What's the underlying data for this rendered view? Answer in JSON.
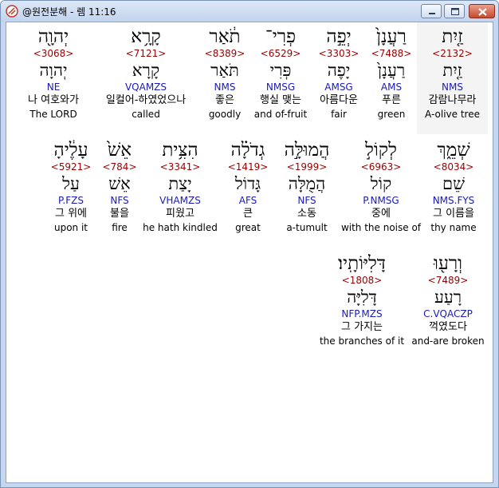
{
  "window": {
    "title": "@원전분해 - 렘 11:16",
    "buttons": {
      "minimize": "minimize",
      "maximize": "maximize",
      "close": "close"
    }
  },
  "words": [
    {
      "heb": "זַ֤יִת",
      "strong": "<2132>",
      "heb2": "זַ֤יִת",
      "morph": "NMS",
      "korean": "감람나무라",
      "english": "A-olive tree"
    },
    {
      "heb": "רַעֲנָן֙",
      "strong": "<7488>",
      "heb2": "רַעֲנָן֙",
      "morph": "AMS",
      "korean": "푸른",
      "english": "green"
    },
    {
      "heb": "יְפֵ֣ה",
      "strong": "<3303>",
      "heb2": "יָפֶה",
      "morph": "AMSG",
      "korean": "아름다운",
      "english": "fair"
    },
    {
      "heb": "פְרִי־",
      "strong": "<6529>",
      "heb2": "פְּרִי",
      "morph": "NMSG",
      "korean": "행실 맺는",
      "english": "and of-fruit"
    },
    {
      "heb": "תֹ֔אַר",
      "strong": "<8389>",
      "heb2": "תֹּאַר",
      "morph": "NMS",
      "korean": "좋은",
      "english": "goodly"
    },
    {
      "heb": "קָרָ֥א",
      "strong": "<7121>",
      "heb2": "קָרָא",
      "morph": "VQAMZS",
      "korean": "일컬어-하였었으나",
      "english": "called"
    },
    {
      "heb": "יְהוָ֖ה",
      "strong": "<3068>",
      "heb2": "יְהוָה",
      "morph": "NE",
      "korean": "나 여호와가",
      "english": "The LORD"
    },
    {
      "heb": "שְׁמֵ֑ךְ",
      "strong": "<8034>",
      "heb2": "שֵׁם",
      "morph": "NMS.FYS",
      "korean": "그 이름을",
      "english": "thy name"
    },
    {
      "heb": "לְקוֹל֣",
      "strong": "<6963>",
      "heb2": "קוֹל",
      "morph": "P.NMSG",
      "korean": "중에",
      "english": "with the noise of"
    },
    {
      "heb": "הֲמוּלָּ֣ה",
      "strong": "<1999>",
      "heb2": "הֲמֻלָּה",
      "morph": "NFS",
      "korean": "소동",
      "english": "a-tumult"
    },
    {
      "heb": "גְדֹלָ֗ה",
      "strong": "<1419>",
      "heb2": "גָּדוֹל",
      "morph": "AFS",
      "korean": "큰",
      "english": "great"
    },
    {
      "heb": "הִצִּ֥ית",
      "strong": "<3341>",
      "heb2": "יָצַת",
      "morph": "VHAMZS",
      "korean": "피웠고",
      "english": "he hath kindled"
    },
    {
      "heb": "אֵשׁ֙",
      "strong": "<784>",
      "heb2": "אֵשׁ",
      "morph": "NFS",
      "korean": "불을",
      "english": "fire"
    },
    {
      "heb": "עָלֶ֔יהָ",
      "strong": "<5921>",
      "heb2": "עַל",
      "morph": "P.FZS",
      "korean": "그 위에",
      "english": "upon it"
    },
    {
      "heb": "וְרָע֖וּ",
      "strong": "<7489>",
      "heb2": "רָעַע",
      "morph": "C.VQACZP",
      "korean": "꺽였도다",
      "english": "and-are broken"
    },
    {
      "heb": "דָּלִיּוֹתָֽיו׃",
      "strong": "<1808>",
      "heb2": "דָּלִיָּה",
      "morph": "NFP.MZS",
      "korean": "그 가지는",
      "english": "the branches of it"
    }
  ]
}
